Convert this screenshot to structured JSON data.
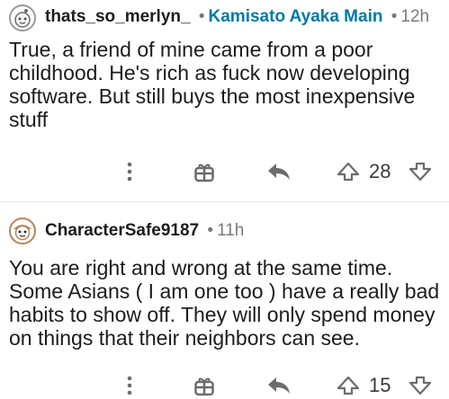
{
  "comments": [
    {
      "username": "thats_so_merlyn_",
      "flair": "Kamisato Ayaka Main",
      "time": "12h",
      "body": "True, a friend of mine came from a poor childhood. He's rich as fuck now developing software. But still buys the most inexpensive stuff",
      "score": "28",
      "avatar_icon": "snoo-avatar-icon"
    },
    {
      "username": "CharacterSafe9187",
      "flair": "",
      "time": "11h",
      "body": "You are right and wrong at the same time. Some Asians ( I am one too ) have a really bad habits to show off. They will only spend money on things that their neighbors can see.",
      "score": "15",
      "avatar_icon": "snoo-avatar-icon"
    }
  ],
  "separator": "•",
  "colors": {
    "flair": "#0079a8",
    "meta_gray": "#7a7a7a",
    "icon_gray": "#6b6b6b"
  }
}
